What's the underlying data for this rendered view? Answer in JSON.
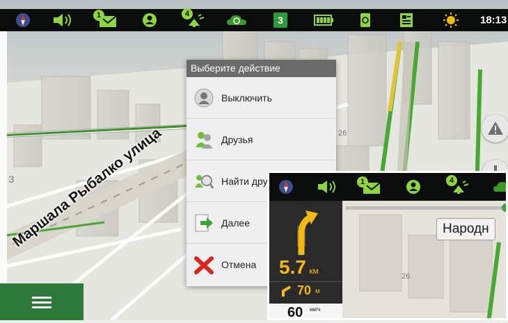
{
  "status_bar": {
    "time": "18:13",
    "icons": [
      "compass-icon",
      "volume-icon",
      "message-icon",
      "friends-icon",
      "satellite-icon",
      "sync-icon",
      "speed-cam-count-icon",
      "battery-icon",
      "refresh-icon",
      "info-icon",
      "daynight-icon"
    ],
    "messages_badge": "1",
    "satellites_badge": "4",
    "counter": "3"
  },
  "map": {
    "street_name": "Маршала Рыбалко улица",
    "block_label": "26",
    "partial_label": "З"
  },
  "action_menu": {
    "title": "Выберите действие",
    "items": [
      {
        "label": "Выключить",
        "icon": "power-icon"
      },
      {
        "label": "Друзья",
        "icon": "friends-icon"
      },
      {
        "label": "Найти друга",
        "icon": "find-friend-icon"
      },
      {
        "label": "Далее",
        "icon": "next-arrow-icon"
      },
      {
        "label": "Отмена",
        "icon": "cancel-icon"
      }
    ]
  },
  "bottom_bar": {
    "menu_icon": "hamburger-menu-icon"
  },
  "inset": {
    "status_bar": {
      "messages_badge": "1",
      "satellites_badge": "4"
    },
    "nav_panel": {
      "distance_value": "5.7",
      "distance_unit": "км",
      "next_turn_value": "70",
      "next_turn_unit": "м",
      "speed_value": "60",
      "speed_unit": "км/ч"
    },
    "street_sign": "Народн",
    "block_label": "26"
  },
  "colors": {
    "accent_green": "#8fd63a",
    "route_green": "#47a834",
    "statusbar_bg": "#0b0d0c",
    "nav_yellow": "#f5b712"
  }
}
